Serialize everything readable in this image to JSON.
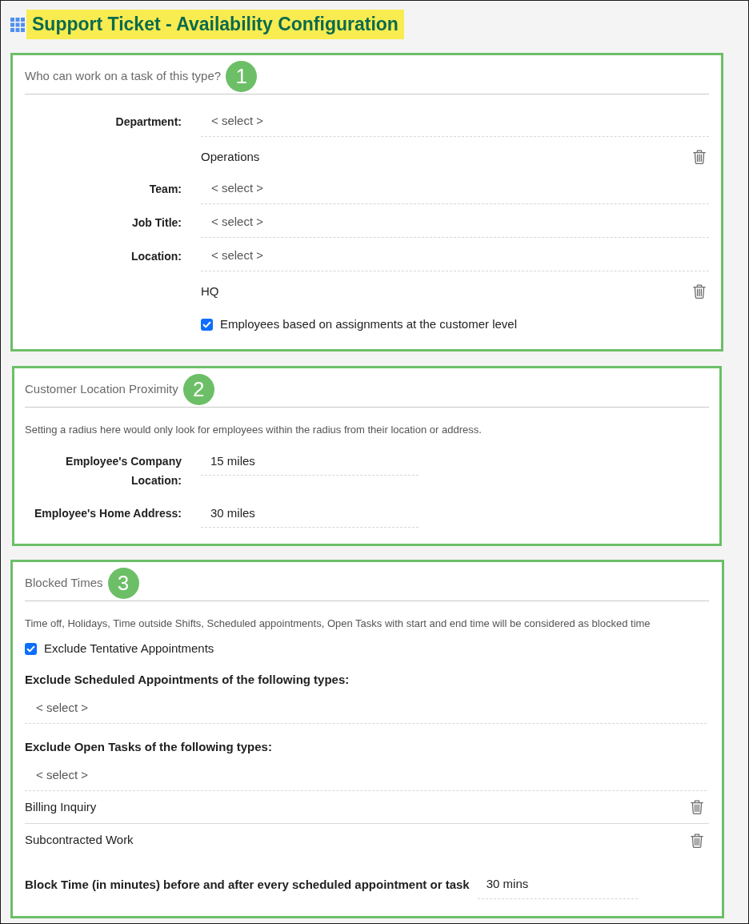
{
  "header": {
    "title": "Support Ticket - Availability Configuration",
    "highlighted": true
  },
  "sections": [
    {
      "kind": "labeled",
      "heading": "Who can work on a task of this type?",
      "badge": "1",
      "rows": [
        {
          "kind": "select",
          "label": "Department:",
          "placeholder": "< select >"
        },
        {
          "kind": "item",
          "value": "Operations"
        },
        {
          "kind": "select",
          "label": "Team:",
          "placeholder": "< select >"
        },
        {
          "kind": "select",
          "label": "Job Title:",
          "placeholder": "< select >"
        },
        {
          "kind": "select",
          "label": "Location:",
          "placeholder": "< select >"
        },
        {
          "kind": "item",
          "value": "HQ"
        },
        {
          "kind": "checkbox",
          "label": "Employees based on assignments at the customer level",
          "checked": true
        }
      ]
    },
    {
      "kind": "labeled",
      "heading": "Customer Location Proximity",
      "badge": "2",
      "description": "Setting a radius here would only look for employees within the radius from their location or address.",
      "rows": [
        {
          "kind": "value",
          "label": "Employee's Company Location:",
          "value": "15 miles"
        },
        {
          "kind": "value",
          "label": "Employee's Home Address:",
          "value": "30 miles"
        }
      ]
    },
    {
      "kind": "stacked",
      "heading": "Blocked Times",
      "badge": "3",
      "description": "Time off, Holidays, Time outside Shifts, Scheduled appointments, Open Tasks with start and end time will be considered as blocked time",
      "rows": [
        {
          "kind": "checkbox",
          "label": "Exclude Tentative Appointments",
          "checked": true
        },
        {
          "kind": "subheading",
          "text": "Exclude Scheduled Appointments of the following types:"
        },
        {
          "kind": "select",
          "placeholder": "< select >"
        },
        {
          "kind": "subheading",
          "text": "Exclude Open Tasks of the following types:"
        },
        {
          "kind": "select",
          "placeholder": "< select >"
        },
        {
          "kind": "item",
          "value": "Billing Inquiry"
        },
        {
          "kind": "item",
          "value": "Subcontracted Work"
        },
        {
          "kind": "value",
          "label": "Block Time (in minutes) before and after every scheduled appointment or task",
          "value": "30 mins"
        }
      ]
    }
  ]
}
